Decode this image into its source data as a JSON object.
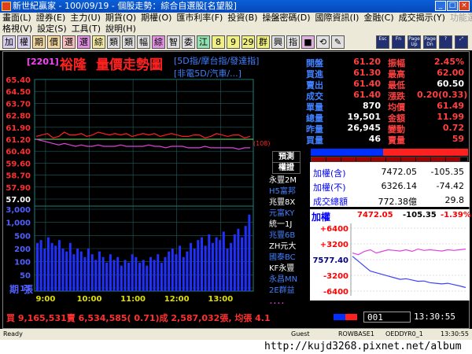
{
  "window": {
    "title": "新世紀贏家 - 100/09/19 - 個股走勢：綜合自選股[名望股]",
    "controls": [
      "_",
      "□",
      "×"
    ]
  },
  "menus": {
    "row1": [
      {
        "label": "畫面(L)"
      },
      {
        "label": "證券(E)"
      },
      {
        "label": "主力(U)"
      },
      {
        "label": "期貨(Q)"
      },
      {
        "label": "期權(O)"
      },
      {
        "label": "匯市利率(F)"
      },
      {
        "label": "投資(B)"
      },
      {
        "label": "操盤密碼(D)"
      },
      {
        "label": "國際資訊(I)"
      },
      {
        "label": "金融(C)"
      },
      {
        "label": "成交揭示(Y)"
      },
      {
        "label": "功能選擇(F)"
      }
    ],
    "row2": [
      {
        "label": "格視(V)"
      },
      {
        "label": "設定(S)"
      },
      {
        "label": "工具(T)"
      },
      {
        "label": "說明(H)"
      }
    ]
  },
  "toolbar": {
    "buttons": [
      {
        "label": "加",
        "color": "#d8d0f0"
      },
      {
        "label": "權",
        "color": "#d8d0f0"
      },
      {
        "label": "期",
        "color": "#f4d8a0"
      },
      {
        "label": "價",
        "color": "#f4d8a0"
      },
      {
        "label": "選",
        "color": "#f8c0c0"
      },
      {
        "label": "選",
        "color": "#e090e0"
      },
      {
        "label": "綜",
        "color": "#f0e8a0"
      },
      {
        "label": "類",
        "color": "#e0e0e0"
      },
      {
        "label": "類",
        "color": "#e0e0e0"
      },
      {
        "label": "幅",
        "color": "#e0e0e0"
      },
      {
        "label": "綜",
        "color": "#e090e0"
      },
      {
        "label": "智",
        "color": "#e0e0e0"
      },
      {
        "label": "委",
        "color": "#e0e0e0"
      },
      {
        "label": "江",
        "color": "#90e0b0"
      },
      {
        "label": "8",
        "color": "#f0f080"
      },
      {
        "label": "9",
        "color": "#f0f080"
      },
      {
        "label": "29",
        "color": "#f0f080"
      },
      {
        "label": "群",
        "color": "#f0f080"
      },
      {
        "label": "興",
        "color": "#e0e0e0"
      },
      {
        "label": "指",
        "color": "#e0e0e0"
      },
      {
        "label": "■",
        "color": "#e0b0e0"
      },
      {
        "label": "⟲",
        "color": "#e0e0e0"
      },
      {
        "label": "✎",
        "color": "#e0e0e0"
      }
    ],
    "right_buttons": [
      "Esc",
      "Fn",
      "Page\nUp",
      "Page\nDn",
      "?",
      "⤢"
    ]
  },
  "stock": {
    "code": "[2201]",
    "name": "裕隆",
    "chart_title": "量價走勢圖",
    "mode_line1": "[5D指/摩台指/發達指]",
    "mode_line2": "[非電5D/汽車/...]",
    "ref_marker": "(108)"
  },
  "quote_left": [
    {
      "label": "開盤",
      "value": "61.20",
      "color": "#ff4040"
    },
    {
      "label": "買進",
      "value": "61.30",
      "color": "#ff4040"
    },
    {
      "label": "賣出",
      "value": "61.40",
      "color": "#ff4040"
    },
    {
      "label": "成交",
      "value": "61.40",
      "color": "#ff4040"
    },
    {
      "label": "單量",
      "value": "870",
      "color": "#ffffff"
    },
    {
      "label": "總量",
      "value": "19,501",
      "color": "#ffffff"
    },
    {
      "label": "昨量",
      "value": "26,945",
      "color": "#ffffff"
    },
    {
      "label": "買量",
      "value": "46",
      "color": "#ffffff"
    }
  ],
  "quote_right": [
    {
      "label": "振幅",
      "value": "2.45%",
      "color": "#ff4040"
    },
    {
      "label": "最高",
      "value": "62.00",
      "color": "#ff4040"
    },
    {
      "label": "最低",
      "value": "60.50",
      "color": "#ffffff"
    },
    {
      "label": "漲跌",
      "value": "0.20(0.33)",
      "color": "#ff4040"
    },
    {
      "label": "均價",
      "value": "61.49",
      "color": "#ff4040"
    },
    {
      "label": "金額",
      "value": "11.99",
      "color": "#ff4040"
    },
    {
      "label": "變動",
      "value": "0.72",
      "color": "#ff4040"
    },
    {
      "label": "賣量",
      "value": "59",
      "color": "#ff4040"
    }
  ],
  "side_list": {
    "header1": "預測",
    "header2": "權證",
    "items": [
      {
        "label": "永豐2M",
        "color": "#ffffff"
      },
      {
        "label": "H5富邦",
        "color": "#4080ff"
      },
      {
        "label": "兆豐8X",
        "color": "#ffffff"
      },
      {
        "label": "元富KY",
        "color": "#4080ff"
      },
      {
        "label": "統一1J",
        "color": "#ffffff"
      },
      {
        "label": "兆豐6B",
        "color": "#4080ff"
      },
      {
        "label": "ZH元大",
        "color": "#ffffff"
      },
      {
        "label": "國泰BC",
        "color": "#4080ff"
      },
      {
        "label": "KF永豐",
        "color": "#ffffff"
      },
      {
        "label": "永昌MN",
        "color": "#4080ff"
      },
      {
        "label": "2E群益",
        "color": "#4080ff"
      },
      {
        "label": "．．．．",
        "color": "#ff40ff"
      }
    ]
  },
  "index_box": {
    "rows": [
      {
        "label": "加權(含)",
        "value": "7472.05",
        "change": "-105.35"
      },
      {
        "label": "加權(不)",
        "value": "6326.14",
        "change": "-74.42"
      },
      {
        "label": "成交總額",
        "value": "772.38億",
        "change": "29.8"
      }
    ]
  },
  "index_mini": {
    "name": "加權",
    "value": "7472.05",
    "change": "-105.35",
    "pct": "-1.39%",
    "left_labels": [
      "+6400",
      "+3200",
      "7577.40",
      "-3200",
      "-6400"
    ]
  },
  "chart_data": {
    "type": "line",
    "x_tick_labels": [
      "9:00",
      "10:00",
      "11:00",
      "12:00",
      "13:00"
    ],
    "price_axis": [
      "65.40",
      "64.50",
      "63.70",
      "62.80",
      "61.90",
      "61.20",
      "60.40",
      "59.60",
      "58.70",
      "57.90",
      "57.00"
    ],
    "volume_axis": [
      "3,000",
      "1,000",
      "500",
      "200",
      "100",
      "50",
      "15"
    ],
    "volume_axis_title": [
      "期",
      "張"
    ],
    "ylim": [
      57.0,
      65.4
    ],
    "reference_price": 61.2,
    "series": [
      {
        "color": "#ff2020",
        "points": [
          61.4,
          61.5,
          61.6,
          61.3,
          61.4,
          61.7,
          61.5,
          61.5,
          61.6,
          61.4,
          61.5,
          61.7,
          61.6,
          61.5,
          61.6,
          61.5,
          61.6,
          61.4,
          61.5,
          61.6,
          61.5,
          61.6,
          61.4,
          61.5,
          61.6,
          61.5,
          61.4,
          61.4,
          61.5,
          61.5,
          61.3,
          61.4,
          61.6,
          61.5,
          61.4,
          61.5,
          61.5,
          61.3,
          61.4
        ]
      },
      {
        "color": "#e040e0",
        "points": [
          61.2,
          61.1,
          61.0,
          60.9,
          60.8,
          60.9,
          60.8,
          60.7,
          60.8,
          60.7,
          60.7,
          60.8,
          60.7,
          60.7,
          60.7,
          60.8,
          60.7,
          60.7,
          60.7,
          60.7,
          60.8,
          60.7,
          60.7,
          60.6,
          60.7,
          60.7,
          60.7,
          60.6,
          60.6,
          60.6,
          60.7,
          60.6,
          60.6,
          60.6,
          60.6,
          60.6,
          60.5,
          60.6,
          60.6
        ]
      }
    ],
    "volume_bars": [
      34,
      36,
      30,
      38,
      34,
      32,
      36,
      30,
      28,
      34,
      26,
      30,
      28,
      24,
      30,
      26,
      22,
      28,
      24,
      20,
      26,
      22,
      24,
      18,
      22,
      20,
      26,
      24,
      20,
      22,
      18,
      24,
      22,
      26,
      20,
      24,
      28,
      30,
      26,
      32,
      24,
      28,
      34,
      30,
      36,
      38,
      32,
      40,
      34,
      38,
      36,
      42,
      30,
      34,
      40,
      44,
      38,
      46,
      54
    ]
  },
  "mini_chart_data": {
    "type": "line",
    "series": [
      {
        "color": "#e040e0",
        "points": [
          0.2,
          0.15,
          0.25,
          0.3,
          0.2,
          0.25,
          0.3,
          0.28,
          0.26,
          0.3,
          0.25,
          0.32,
          0.28,
          0.3,
          0.28,
          0.26,
          0.3,
          0.28,
          0.3,
          0.32
        ]
      },
      {
        "color": "#4040ff",
        "points": [
          0.1,
          -0.05,
          -0.2,
          -0.35,
          -0.4,
          -0.45,
          -0.5,
          -0.55,
          -0.6,
          -0.58,
          -0.62,
          -0.66,
          -0.65,
          -0.7,
          -0.72,
          -0.74,
          -0.72,
          -0.76,
          -0.8,
          -0.85
        ]
      }
    ]
  },
  "bottom_line": {
    "text": "買 9,165,531賣 6,534,585( 0.71)成 2,587,032張, 均張 4.1",
    "page_field": "001",
    "clock": "13:30:55"
  },
  "statusbar": {
    "items": [
      "Ready",
      "Guest",
      "ROWBASE1",
      "OEDDYR0_1",
      "13:30:55"
    ]
  },
  "watermark": "http://kujd3268.pixnet.net/album"
}
